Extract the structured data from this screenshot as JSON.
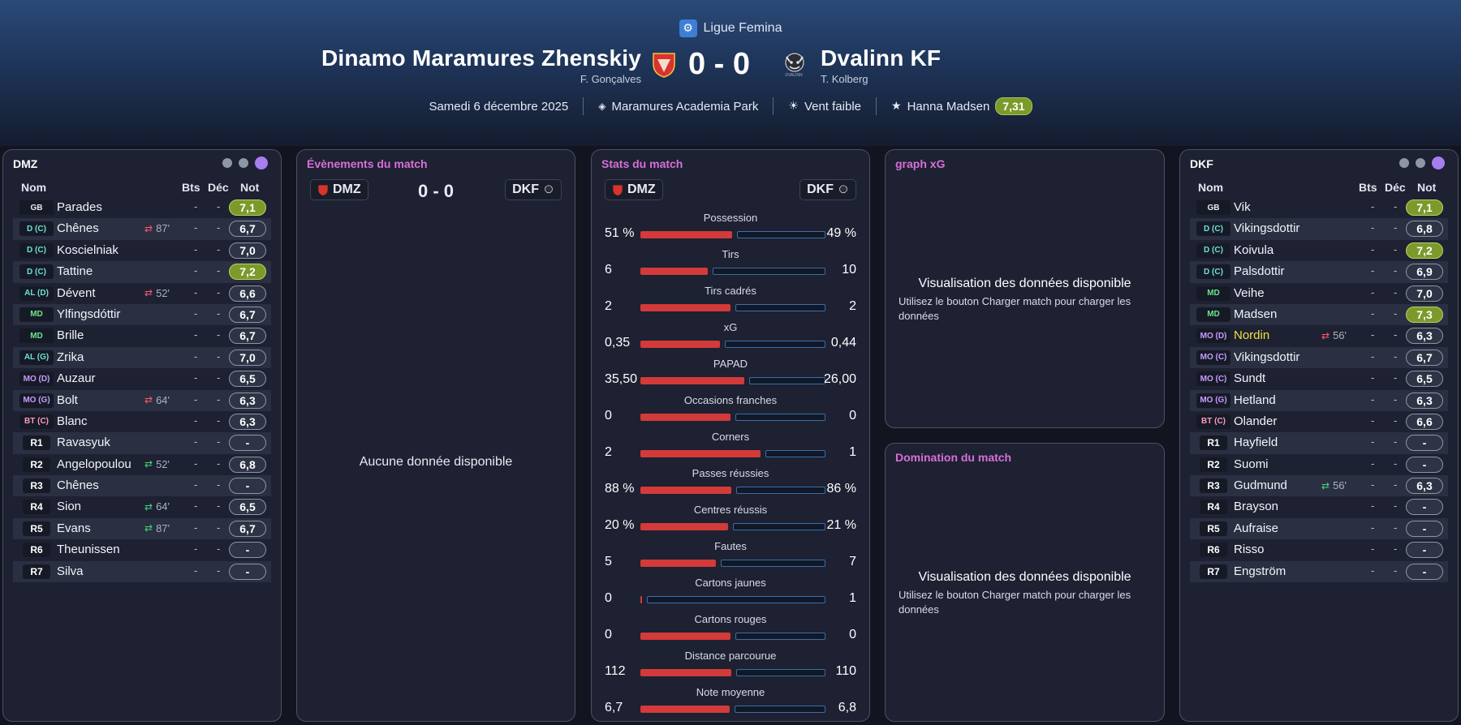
{
  "header": {
    "league": "Ligue Femina",
    "home_team": "Dinamo Maramures Zhenskiy",
    "home_coach": "F. Gonçalves",
    "away_team": "Dvalinn KF",
    "away_coach": "T. Kolberg",
    "score": "0 - 0",
    "date": "Samedi 6 décembre 2025",
    "stadium": "Maramures Academia Park",
    "weather": "Vent faible",
    "motm": "Hanna Madsen",
    "motm_rating": "7,31",
    "away_crest_text": "DVALINN"
  },
  "home_panel": {
    "title": "DMZ",
    "col_name": "Nom",
    "col_goals": "Bts",
    "col_dec": "Déc",
    "col_rating": "Not",
    "players": [
      {
        "pos": "GB",
        "name": "Parades",
        "bts": "-",
        "dec": "-",
        "rating": "7,1",
        "good": true
      },
      {
        "pos": "D (C)",
        "name": "Chênes",
        "sub": "87'",
        "sub_dir": "out",
        "bts": "-",
        "dec": "-",
        "rating": "6,7"
      },
      {
        "pos": "D (C)",
        "name": "Koscielniak",
        "bts": "-",
        "dec": "-",
        "rating": "7,0"
      },
      {
        "pos": "D (C)",
        "name": "Tattine",
        "bts": "-",
        "dec": "-",
        "rating": "7,2",
        "good": true
      },
      {
        "pos": "AL (D)",
        "name": "Dévent",
        "sub": "52'",
        "sub_dir": "out",
        "bts": "-",
        "dec": "-",
        "rating": "6,6"
      },
      {
        "pos": "MD",
        "name": "Ylfingsdóttir",
        "bts": "-",
        "dec": "-",
        "rating": "6,7"
      },
      {
        "pos": "MD",
        "name": "Brille",
        "bts": "-",
        "dec": "-",
        "rating": "6,7"
      },
      {
        "pos": "AL (G)",
        "name": "Zrika",
        "bts": "-",
        "dec": "-",
        "rating": "7,0"
      },
      {
        "pos": "MO (D)",
        "name": "Auzaur",
        "bts": "-",
        "dec": "-",
        "rating": "6,5"
      },
      {
        "pos": "MO (G)",
        "name": "Bolt",
        "sub": "64'",
        "sub_dir": "out",
        "bts": "-",
        "dec": "-",
        "rating": "6,3"
      },
      {
        "pos": "BT (C)",
        "name": "Blanc",
        "bts": "-",
        "dec": "-",
        "rating": "6,3"
      },
      {
        "pos": "R1",
        "name": "Ravasyuk",
        "bts": "-",
        "dec": "-",
        "rating": "-"
      },
      {
        "pos": "R2",
        "name": "Angelopoulou",
        "sub": "52'",
        "sub_dir": "in",
        "bts": "-",
        "dec": "-",
        "rating": "6,8"
      },
      {
        "pos": "R3",
        "name": "Chênes",
        "bts": "-",
        "dec": "-",
        "rating": "-"
      },
      {
        "pos": "R4",
        "name": "Sion",
        "sub": "64'",
        "sub_dir": "in",
        "bts": "-",
        "dec": "-",
        "rating": "6,5"
      },
      {
        "pos": "R5",
        "name": "Evans",
        "sub": "87'",
        "sub_dir": "in",
        "bts": "-",
        "dec": "-",
        "rating": "6,7"
      },
      {
        "pos": "R6",
        "name": "Theunissen",
        "bts": "-",
        "dec": "-",
        "rating": "-"
      },
      {
        "pos": "R7",
        "name": "Silva",
        "bts": "-",
        "dec": "-",
        "rating": "-"
      }
    ]
  },
  "away_panel": {
    "title": "DKF",
    "col_name": "Nom",
    "col_goals": "Bts",
    "col_dec": "Déc",
    "col_rating": "Not",
    "players": [
      {
        "pos": "GB",
        "name": "Vik",
        "bts": "-",
        "dec": "-",
        "rating": "7,1",
        "good": true
      },
      {
        "pos": "D (C)",
        "name": "Vikingsdottir",
        "bts": "-",
        "dec": "-",
        "rating": "6,8"
      },
      {
        "pos": "D (C)",
        "name": "Koivula",
        "bts": "-",
        "dec": "-",
        "rating": "7,2",
        "good": true
      },
      {
        "pos": "D (C)",
        "name": "Palsdottir",
        "bts": "-",
        "dec": "-",
        "rating": "6,9"
      },
      {
        "pos": "MD",
        "name": "Veihe",
        "bts": "-",
        "dec": "-",
        "rating": "7,0"
      },
      {
        "pos": "MD",
        "name": "Madsen",
        "bts": "-",
        "dec": "-",
        "rating": "7,3",
        "good": true
      },
      {
        "pos": "MO (D)",
        "name": "Nordin",
        "sub": "56'",
        "sub_dir": "out",
        "bts": "-",
        "dec": "-",
        "rating": "6,3",
        "highlight": true
      },
      {
        "pos": "MO (C)",
        "name": "Vikingsdottir",
        "bts": "-",
        "dec": "-",
        "rating": "6,7"
      },
      {
        "pos": "MO (C)",
        "name": "Sundt",
        "bts": "-",
        "dec": "-",
        "rating": "6,5"
      },
      {
        "pos": "MO (G)",
        "name": "Hetland",
        "bts": "-",
        "dec": "-",
        "rating": "6,3"
      },
      {
        "pos": "BT (C)",
        "name": "Olander",
        "bts": "-",
        "dec": "-",
        "rating": "6,6"
      },
      {
        "pos": "R1",
        "name": "Hayfield",
        "bts": "-",
        "dec": "-",
        "rating": "-"
      },
      {
        "pos": "R2",
        "name": "Suomi",
        "bts": "-",
        "dec": "-",
        "rating": "-"
      },
      {
        "pos": "R3",
        "name": "Gudmund",
        "sub": "56'",
        "sub_dir": "in",
        "bts": "-",
        "dec": "-",
        "rating": "6,3"
      },
      {
        "pos": "R4",
        "name": "Brayson",
        "bts": "-",
        "dec": "-",
        "rating": "-"
      },
      {
        "pos": "R5",
        "name": "Aufraise",
        "bts": "-",
        "dec": "-",
        "rating": "-"
      },
      {
        "pos": "R6",
        "name": "Risso",
        "bts": "-",
        "dec": "-",
        "rating": "-"
      },
      {
        "pos": "R7",
        "name": "Engström",
        "bts": "-",
        "dec": "-",
        "rating": "-"
      }
    ]
  },
  "events_panel": {
    "title": "Évènements du match",
    "home_abbr": "DMZ",
    "away_abbr": "DKF",
    "score": "0 - 0",
    "empty": "Aucune donnée disponible"
  },
  "stats_panel": {
    "title": "Stats du match",
    "home_abbr": "DMZ",
    "away_abbr": "DKF",
    "stats": [
      {
        "label": "Possession",
        "home": "51 %",
        "away": "49 %",
        "home_share": 0.51
      },
      {
        "label": "Tirs",
        "home": "6",
        "away": "10",
        "home_share": 0.375
      },
      {
        "label": "Tirs cadrés",
        "home": "2",
        "away": "2",
        "home_share": 0.5
      },
      {
        "label": "xG",
        "home": "0,35",
        "away": "0,44",
        "home_share": 0.44
      },
      {
        "label": "PAPAD",
        "home": "35,50",
        "away": "26,00",
        "home_share": 0.577
      },
      {
        "label": "Occasions franches",
        "home": "0",
        "away": "0",
        "home_share": 0.5
      },
      {
        "label": "Corners",
        "home": "2",
        "away": "1",
        "home_share": 0.667
      },
      {
        "label": "Passes réussies",
        "home": "88 %",
        "away": "86 %",
        "home_share": 0.506
      },
      {
        "label": "Centres réussis",
        "home": "20 %",
        "away": "21 %",
        "home_share": 0.488
      },
      {
        "label": "Fautes",
        "home": "5",
        "away": "7",
        "home_share": 0.417
      },
      {
        "label": "Cartons jaunes",
        "home": "0",
        "away": "1",
        "home_share": 0.0
      },
      {
        "label": "Cartons rouges",
        "home": "0",
        "away": "0",
        "home_share": 0.5
      },
      {
        "label": "Distance parcourue",
        "home": "112",
        "away": "110",
        "home_share": 0.505
      },
      {
        "label": "Note moyenne",
        "home": "6,7",
        "away": "6,8",
        "home_share": 0.496
      }
    ]
  },
  "xg_panel": {
    "title": "graph xG",
    "msg_title": "Visualisation des données disponible",
    "msg_sub": "Utilisez le bouton Charger match pour charger les données"
  },
  "domination_panel": {
    "title": "Domination du match",
    "msg_title": "Visualisation des données disponible",
    "msg_sub": "Utilisez le bouton Charger match pour charger les données"
  },
  "colors": {
    "home_bar": "#d33a3a",
    "away_bar_border": "#3b6ea8",
    "good_rating": "#7b9a2a",
    "accent_title": "#d86fd8",
    "active_dot": "#a77ef0"
  }
}
